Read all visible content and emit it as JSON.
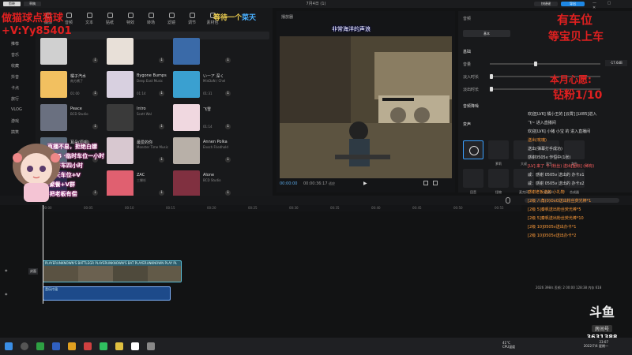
{
  "titlebar": {
    "logo": "剪映",
    "project": "草稿",
    "title": "7月4日 (1)",
    "export_secondary": "快捷键",
    "export_primary": "导出",
    "window_controls": "— ▢ ✕"
  },
  "toolbar": {
    "items": [
      "媒体",
      "音频",
      "文本",
      "贴纸",
      "特效",
      "转场",
      "滤镜",
      "调节",
      "素材包"
    ]
  },
  "categories": [
    "推荐",
    "音乐",
    "收藏",
    "抖音",
    "卡点",
    "旅行",
    "VLOG",
    "游戏",
    "搞笑"
  ],
  "media": {
    "items": [
      {
        "title": "",
        "artist": "",
        "duration": ""
      },
      {
        "title": "",
        "artist": "",
        "duration": ""
      },
      {
        "title": "",
        "artist": "",
        "duration": ""
      },
      {
        "title": "橘子汽水",
        "artist": "南方酱了",
        "duration": "01:00"
      },
      {
        "title": "Bygone Bumps",
        "artist": "Deep East Music",
        "duration": "01:14"
      },
      {
        "title": "いーア 深く",
        "artist": "MinDaN / Chel",
        "duration": "01:31"
      },
      {
        "title": "Peace",
        "artist": "BCD Studio",
        "duration": ""
      },
      {
        "title": "Intro",
        "artist": "Scott Wal",
        "duration": ""
      },
      {
        "title": "飞雪",
        "artist": "",
        "duration": "01:14"
      },
      {
        "title": "耳朵(原唱)",
        "artist": "",
        "duration": ""
      },
      {
        "title": "最爱的你",
        "artist": "Monster Time Music",
        "duration": ""
      },
      {
        "title": "Annen Polka",
        "artist": "Enoch Friedhold",
        "duration": ""
      },
      {
        "title": "Chi-",
        "artist": "",
        "duration": ""
      },
      {
        "title": "ZAC",
        "artist": "三棵杉",
        "duration": ""
      },
      {
        "title": "Alone",
        "artist": "BCD Studio",
        "duration": ""
      }
    ]
  },
  "player": {
    "title": "播放器",
    "timecode": "00:00:00",
    "total": "00:00:36:17",
    "quality": "适应",
    "play_icon": "▶"
  },
  "props": {
    "header": "音频",
    "tab": "基本",
    "sections": [
      "基础",
      "音量",
      "淡入时长",
      "淡出时长",
      "变速",
      "音频降噪",
      "变声"
    ],
    "volume_value": "-17.6dB",
    "voice_effects": [
      "无",
      "萝莉",
      "大叔",
      "男生",
      "女生",
      "怪物",
      "机器人",
      "合成器",
      "回音",
      "低音",
      "麦克风",
      "扩音器"
    ]
  },
  "overlay": {
    "top_left": "做猫球点猫球",
    "wechat": "+V:Yy85401",
    "waiting": "等待一个",
    "waiting_highlight": "菜天",
    "banner": "非常海洋的声浪",
    "right1": "有车位",
    "right2": "等宝贝上车",
    "right3": "本月心愿:",
    "right4": "钻粉1/10",
    "lines": [
      "直播不易，拒绝白嫖",
      "1 ×5 ·临时车位一小时",
      "6 ·普车四小时",
      "·全天车位+V",
      "·聚餐+V群",
      "·把老板有偿"
    ]
  },
  "timeline": {
    "ruler": [
      "00:00",
      "00:05",
      "00:10",
      "00:15",
      "00:20",
      "00:25",
      "00:30",
      "00:35",
      "00:40",
      "00:45",
      "00:50",
      "00:55"
    ],
    "video_label": "PLAYERUNKNOWN'S BATTLEGR PLAYERUNKNOWN'S BAT PLAYERUNKNOWN PLAY PL",
    "cover_label": "封面",
    "audio_label": "音乐片段"
  },
  "chat": {
    "messages": [
      {
        "text": "欢迎[LV6] 橘小王的 [云霄] [LV85]进入",
        "color": "#dddddd"
      },
      {
        "text": "飞~ 进入直播间",
        "color": "#dddddd"
      },
      {
        "text": "欢迎[LV6] 小猪 小宝 的 进入直播间",
        "color": "#dddddd"
      },
      {
        "text": "送出(玫瑰)",
        "color": "#ff9c3a"
      },
      {
        "text": "送出(弹幕打手成功)",
        "color": "#dddddd"
      },
      {
        "text": "感谢0505v 作恒中(1张)",
        "color": "#dddddd"
      },
      {
        "text": "[LV] 来了 卡 (粉丝) 送出[图标] (稀有)",
        "color": "#ff6060"
      },
      {
        "text": "戚：感谢 0505v 送出的 办卡x1",
        "color": "#dddddd"
      },
      {
        "text": "戚：感谢 0505v 送出的 办卡x2",
        "color": "#dddddd"
      },
      {
        "text": "感谢老板送的 小礼物",
        "color": "#ff9c3a"
      },
      {
        "text": "[2级 八角(0)OxO送出粉丝荧光棒*1",
        "color": "#ff9c3a"
      },
      {
        "text": "[2级 5]秦帆送出粉丝荧光棒*5",
        "color": "#ff9c3a"
      },
      {
        "text": "[2级 5]秦帆送出粉丝荧光棒*10",
        "color": "#ff9c3a"
      },
      {
        "text": "[2级 10]0505v送出办卡*1",
        "color": "#ff9c3a"
      },
      {
        "text": "[2级 10]0505v送出办卡*2",
        "color": "#ff9c3a"
      }
    ]
  },
  "status": {
    "text": "2026 398/s 丢帧: 2 00:00 128:38 内存 618"
  },
  "douyu": {
    "logo": "斗鱼",
    "room_label": "房间号",
    "room": "3631388"
  },
  "tray": {
    "temp": "41°C",
    "cpu": "CPU温度",
    "time": "23:07",
    "date": "2022/7/4 星期一"
  },
  "colors": {
    "accent": "#1e88e5",
    "overlay_red": "#e02020",
    "clip_video": "#2e5d6b",
    "clip_audio": "#1d4a8a"
  }
}
